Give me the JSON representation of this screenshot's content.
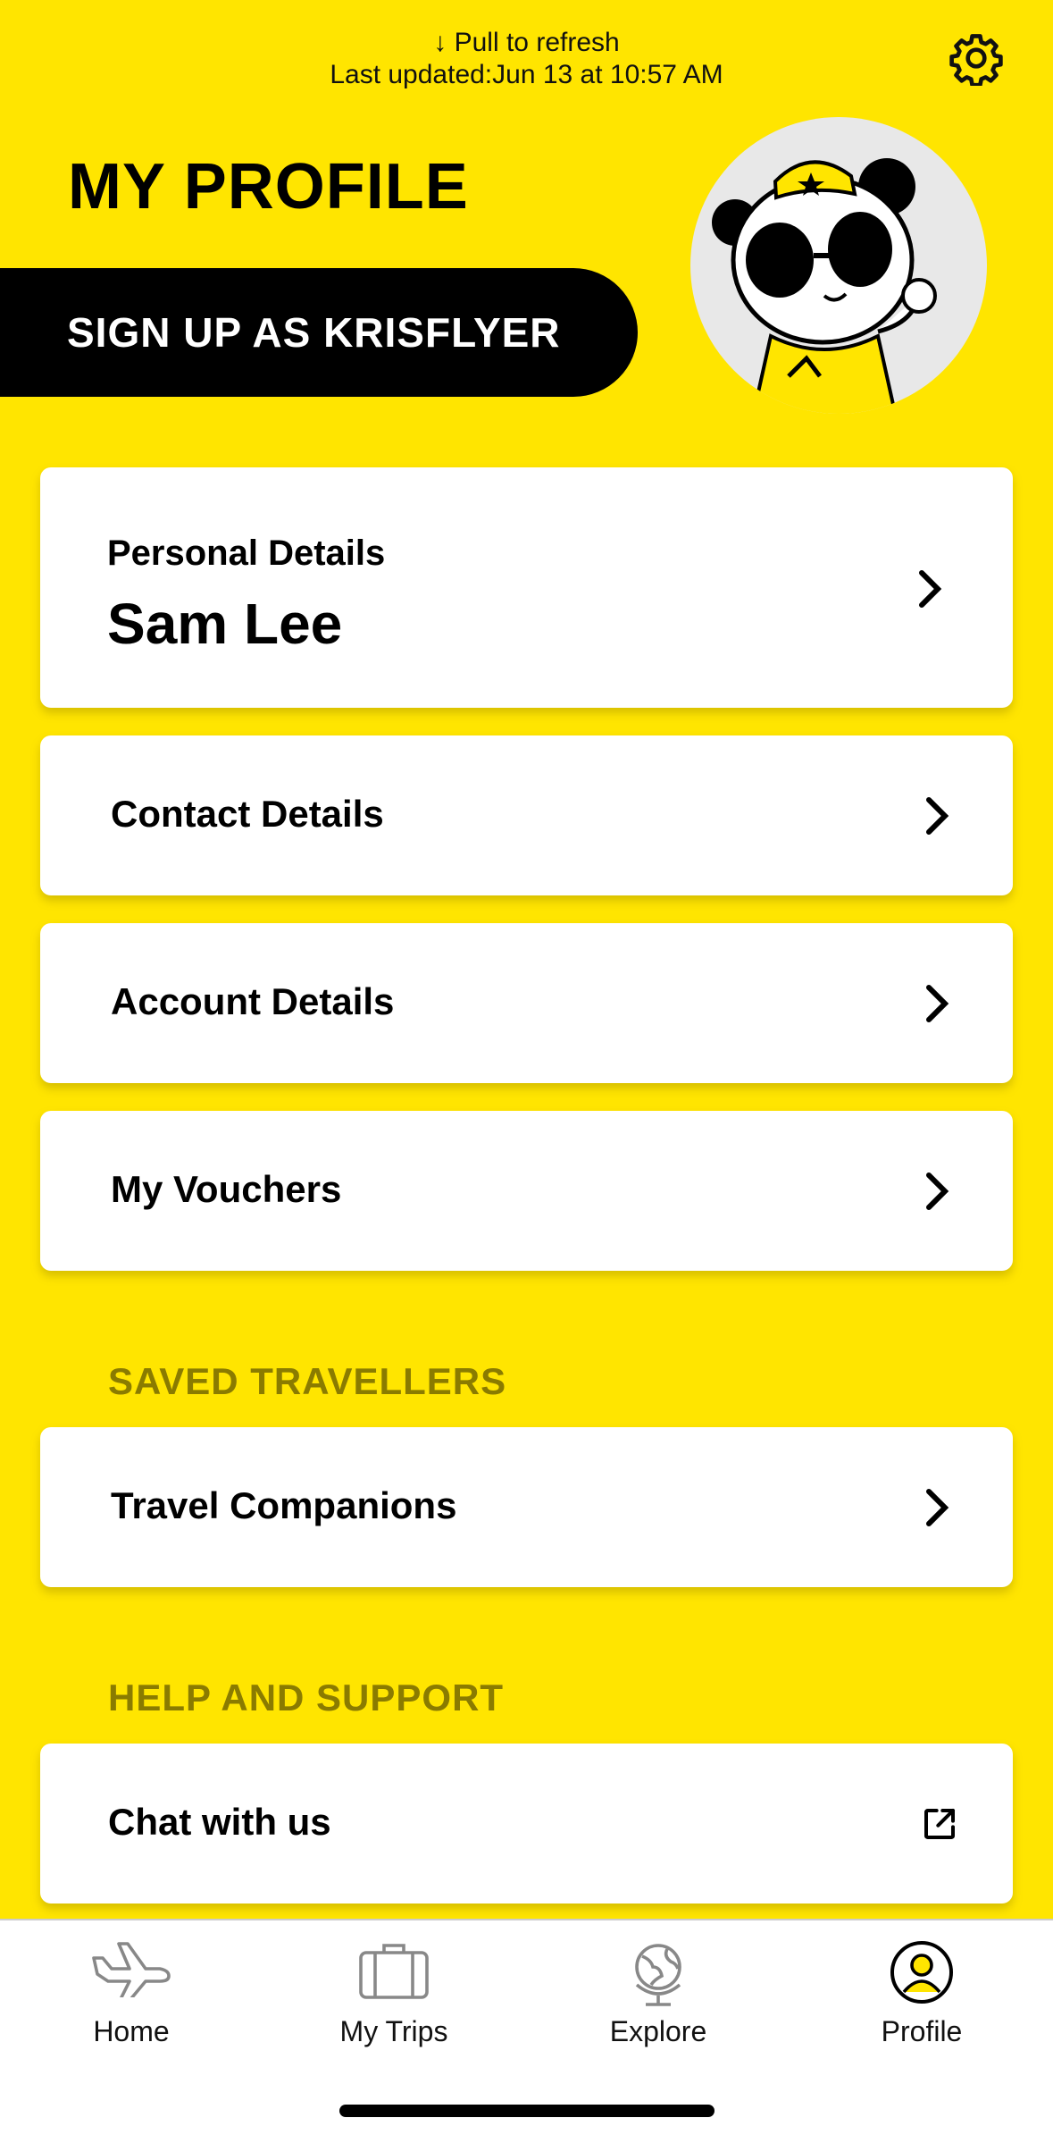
{
  "header": {
    "refresh_hint": "↓ Pull to refresh",
    "last_updated": "Last updated:Jun 13 at 10:57 AM",
    "title": "MY PROFILE",
    "signup_label": "SIGN UP AS KRISFLYER"
  },
  "personal": {
    "label": "Personal Details",
    "name": "Sam Lee"
  },
  "menu": {
    "contact": "Contact Details",
    "account": "Account Details",
    "vouchers": "My Vouchers"
  },
  "saved_travellers": {
    "heading": "SAVED TRAVELLERS",
    "companions": "Travel Companions"
  },
  "help": {
    "heading": "HELP AND SUPPORT",
    "chat": "Chat with us"
  },
  "tabs": {
    "home": "Home",
    "trips": "My Trips",
    "explore": "Explore",
    "profile": "Profile"
  },
  "colors": {
    "background": "#FFE500",
    "section_heading": "#8A7B00",
    "card": "#FFFFFF"
  },
  "icons": [
    "gear-icon",
    "chevron-right-icon",
    "external-link-icon",
    "plane-icon",
    "suitcase-icon",
    "globe-icon",
    "profile-icon"
  ]
}
